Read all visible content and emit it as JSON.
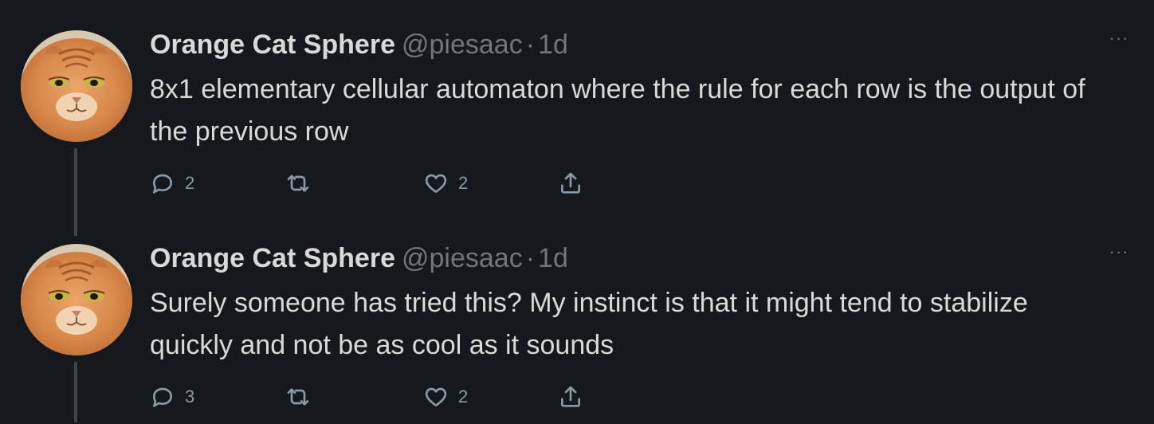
{
  "tweets": [
    {
      "author": {
        "name": "Orange Cat Sphere",
        "handle": "@piesaac",
        "avatar_icon": "orange-cat-avatar"
      },
      "separator": "·",
      "time": "1d",
      "more_icon": "more-horizontal-icon",
      "text": "8x1 elementary cellular automaton where the rule for each row is the output of the previous row",
      "actions": {
        "reply_count": "2",
        "retweet_count": "",
        "like_count": "2"
      }
    },
    {
      "author": {
        "name": "Orange Cat Sphere",
        "handle": "@piesaac",
        "avatar_icon": "orange-cat-avatar"
      },
      "separator": "·",
      "time": "1d",
      "more_icon": "more-horizontal-icon",
      "text": "Surely someone has tried this? My instinct is that it might tend to stabilize quickly and not be as cool as it sounds",
      "actions": {
        "reply_count": "3",
        "retweet_count": "",
        "like_count": "2"
      }
    }
  ],
  "colors": {
    "background": "#15181c",
    "primary_text": "#d9d9d9",
    "secondary_text": "#71767b",
    "thread_line": "#3d4349"
  }
}
